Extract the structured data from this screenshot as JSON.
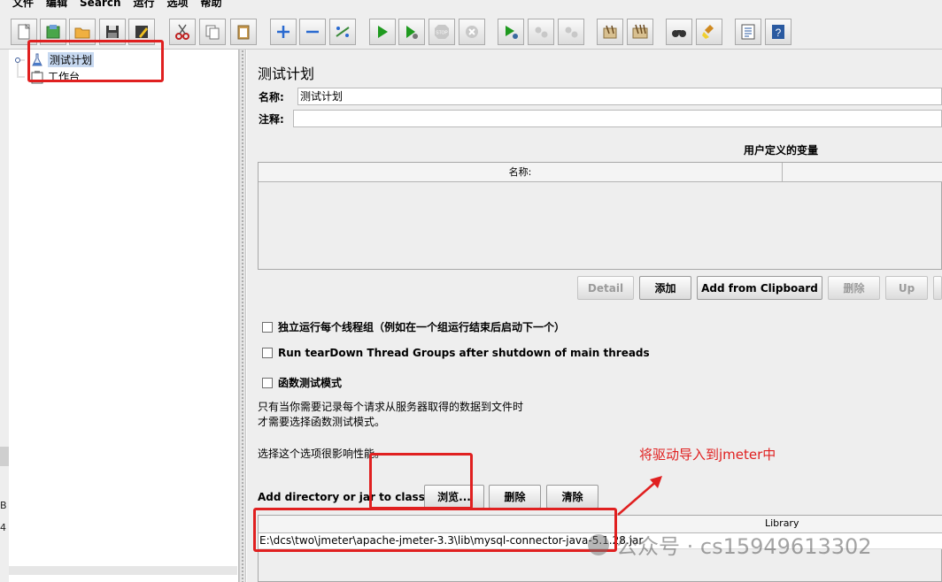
{
  "menubar": [
    "文件",
    "编辑",
    "Search",
    "运行",
    "选项",
    "帮助"
  ],
  "toolbar": {
    "buttons": [
      "new-icon",
      "templates-icon",
      "open-icon",
      "save-icon",
      "save-as-icon",
      "cut-icon",
      "copy-icon",
      "paste-icon",
      "expand-icon",
      "collapse-icon",
      "toggle-icon",
      "start-icon",
      "start-no-pause-icon",
      "stop-icon",
      "shutdown-icon",
      "remote-start-icon",
      "remote-stop-icon",
      "remote-shutdown-icon",
      "clear-icon",
      "clear-all-icon",
      "search-icon",
      "reset-search-icon",
      "function-helper-icon",
      "help-icon"
    ]
  },
  "tree": {
    "test_plan": "测试计划",
    "workbench": "工作台"
  },
  "left_cut": {
    "a": "B",
    "b": "4"
  },
  "panel": {
    "title": "测试计划",
    "name_label": "名称:",
    "name_value": "测试计划",
    "comment_label": "注释:",
    "comment_value": ""
  },
  "user_vars": {
    "section_title": "用户定义的变量",
    "col_name": "名称:",
    "buttons": {
      "detail": "Detail",
      "add": "添加",
      "add_clipboard": "Add from Clipboard",
      "delete": "删除",
      "up": "Up"
    }
  },
  "options": {
    "serialize": "独立运行每个线程组（例如在一个组运行结束后启动下一个）",
    "teardown": "Run tearDown Thread Groups after shutdown of main threads",
    "functional": "函数测试模式",
    "note_line1": "只有当你需要记录每个请求从服务器取得的数据到文件时",
    "note_line2": "才需要选择函数测试模式。",
    "note_line3": "选择这个选项很影响性能。"
  },
  "classpath": {
    "label": "Add directory or jar to classpath",
    "browse": "浏览...",
    "delete": "删除",
    "clear": "清除",
    "col_library": "Library",
    "rows": [
      "E:\\dcs\\two\\jmeter\\apache-jmeter-3.3\\lib\\mysql-connector-java-5.1.28.jar"
    ]
  },
  "annotation": "将驱动导入到jmeter中",
  "watermark": "公众号 · cs15949613302",
  "colors": {
    "annotation": "#e02020",
    "selection": "#c6d8f0"
  }
}
